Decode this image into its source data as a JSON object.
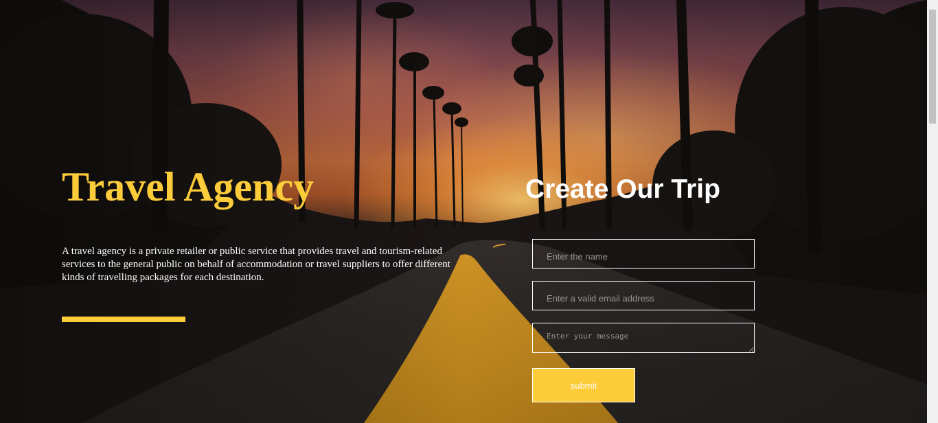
{
  "hero": {
    "title": "Travel Agency",
    "description": "A travel agency is a private retailer or public service that provides travel and tourism-related services to the general public on behalf of accommodation or travel suppliers to offer different kinds of travelling packages for each destination."
  },
  "form": {
    "title": "Create Our Trip",
    "name_placeholder": "Enter the name",
    "email_placeholder": "Enter a valid email address",
    "message_placeholder": "Enter your message",
    "submit_label": "submit"
  },
  "colors": {
    "accent": "#fccc3a",
    "text": "#ffffff"
  }
}
